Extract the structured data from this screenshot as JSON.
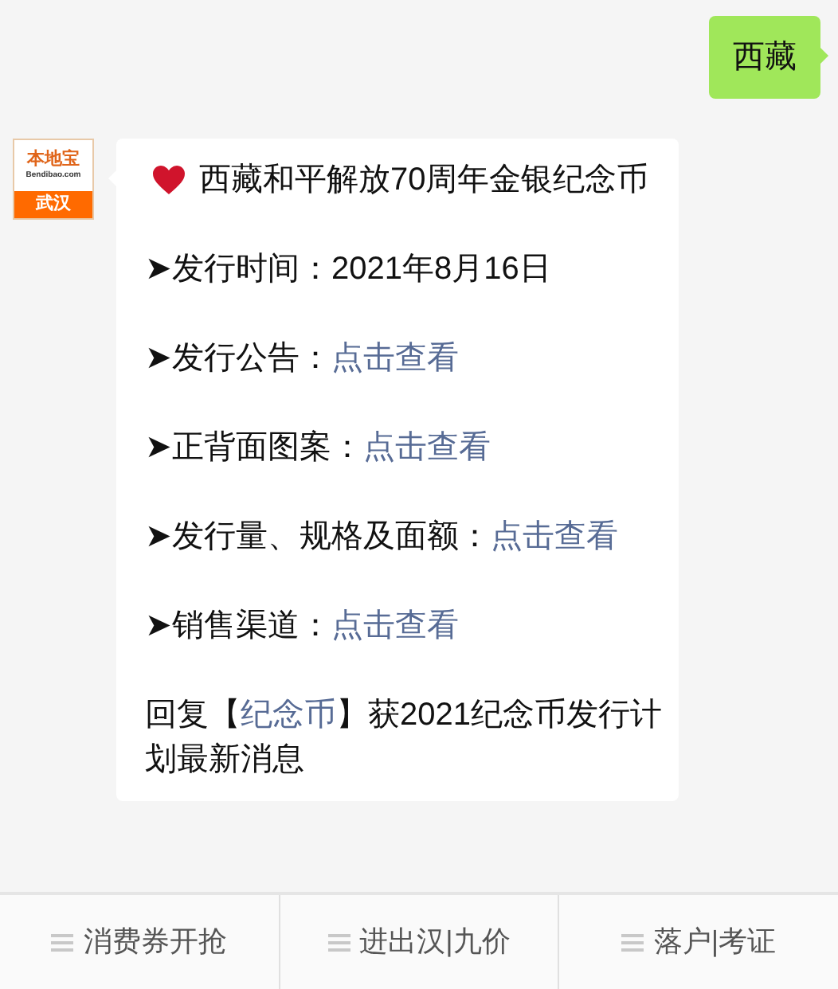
{
  "sent_message": {
    "text": "西藏"
  },
  "sender": {
    "logo_title": "本地宝",
    "logo_domain": "Bendibao.com",
    "logo_city": "武汉"
  },
  "received_message": {
    "title": "西藏和平解放70周年金银纪念币",
    "lines": [
      {
        "bullet": "➤",
        "label": "发行时间：2021年8月16日"
      },
      {
        "bullet": "➤",
        "label": "发行公告：",
        "link": "点击查看"
      },
      {
        "bullet": "➤",
        "label": "正背面图案：",
        "link": "点击查看"
      },
      {
        "bullet": "➤",
        "label": "发行量、规格及面额：",
        "link": "点击查看"
      },
      {
        "bullet": "➤",
        "label": "销售渠道：",
        "link": "点击查看"
      }
    ],
    "footer": {
      "before": "回复【",
      "link": "纪念币",
      "after": "】获2021纪念币发行计划最新消息"
    }
  },
  "menu": [
    {
      "label": "消费券开抢"
    },
    {
      "label": "进出汉|九价"
    },
    {
      "label": "落户|考证"
    }
  ]
}
